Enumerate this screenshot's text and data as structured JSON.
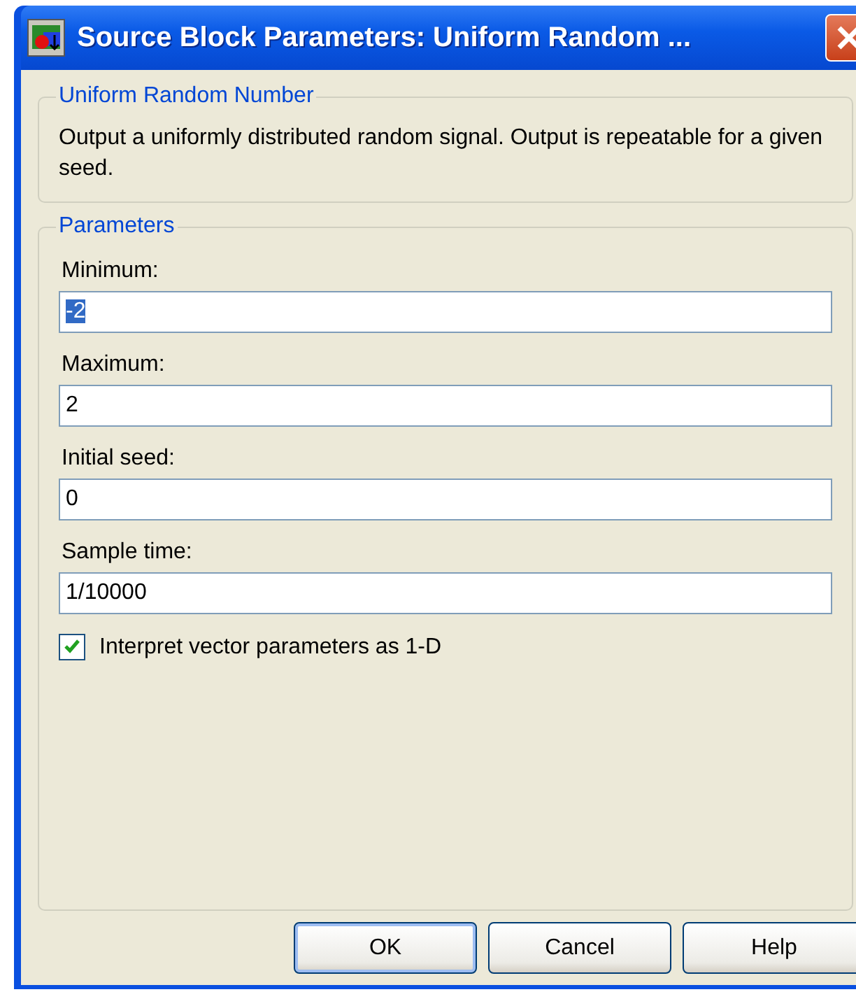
{
  "window": {
    "title": "Source Block Parameters: Uniform Random ..."
  },
  "description_group": {
    "title": "Uniform Random Number",
    "text": "Output a uniformly distributed random signal.  Output is repeatable for a given seed."
  },
  "parameters_group": {
    "title": "Parameters",
    "fields": [
      {
        "label": "Minimum:",
        "value": "-2",
        "value_selected": true
      },
      {
        "label": "Maximum:",
        "value": "2",
        "value_selected": false
      },
      {
        "label": "Initial seed:",
        "value": "0",
        "value_selected": false
      },
      {
        "label": "Sample time:",
        "value": "1/10000",
        "value_selected": false
      }
    ],
    "checkbox": {
      "label": "Interpret vector parameters as 1-D",
      "checked": true
    }
  },
  "buttons": [
    {
      "label": "OK",
      "default": true
    },
    {
      "label": "Cancel",
      "default": false
    },
    {
      "label": "Help",
      "default": false
    }
  ]
}
